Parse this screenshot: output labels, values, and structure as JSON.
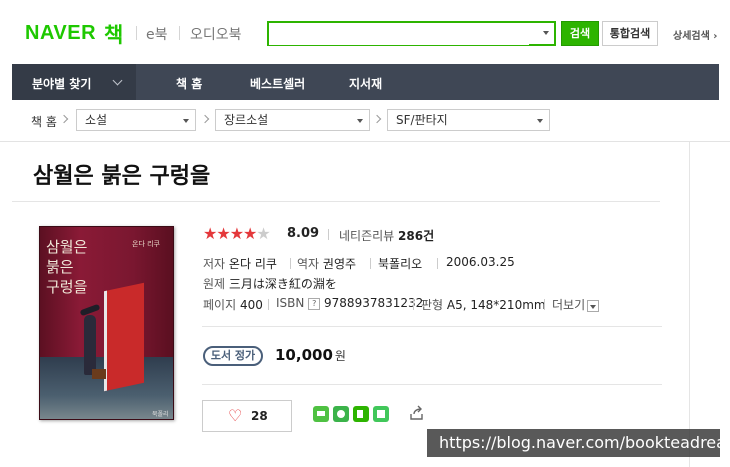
{
  "header": {
    "logo_text": "NAVER",
    "service_name": "책",
    "services": [
      "e북",
      "오디오북"
    ],
    "search": {
      "value": "",
      "placeholder": ""
    },
    "search_button": "검색",
    "total_search_button": "통합검색",
    "advanced_search_link": "상세검색 ›"
  },
  "nav": {
    "category_label": "분야별 찾기",
    "items": [
      "책 홈",
      "베스트셀러",
      "지서재"
    ]
  },
  "breadcrumb": {
    "home": "책 홈",
    "selects": [
      "소설",
      "장르소설",
      "SF/판타지"
    ]
  },
  "book": {
    "title": "삼월은 붉은 구렁을",
    "cover": {
      "title_lines": [
        "삼월은",
        "붉은",
        "구렁을"
      ],
      "author_text": "온다 리쿠",
      "publisher_text": "북폴리오"
    },
    "rating": {
      "stars_on": "★★★★",
      "stars_off": "★",
      "score": "8.09",
      "review_label": "네티즌리뷰",
      "review_count": "286",
      "review_unit": "건"
    },
    "details": {
      "author_label": "저자",
      "author": "온다 리쿠",
      "translator_label": "역자",
      "translator": "권영주",
      "publisher": "북폴리오",
      "date": "2006.03.25",
      "original_label": "원제",
      "original_title": "三月は深き紅の淵を",
      "pages_label": "페이지",
      "pages": "400",
      "isbn_label": "ISBN",
      "isbn_icon": "?",
      "isbn": "9788937831232",
      "format_label": "판형",
      "format": "A5, 148*210mm",
      "more_label": "더보기"
    },
    "price": {
      "badge": "도서 정가",
      "amount": "10,000",
      "unit": "원"
    },
    "like": {
      "count": "28"
    },
    "share": [
      "band-icon",
      "kakao-icon",
      "naver-blog-icon",
      "line-icon",
      "share-arrow-icon"
    ]
  },
  "watermark": "https://blog.naver.com/bookteadream",
  "colors": {
    "brand_green": "#2db400",
    "nav_bg": "#3f4755",
    "star_red": "#e4383b",
    "price_badge": "#4a5f7a"
  }
}
